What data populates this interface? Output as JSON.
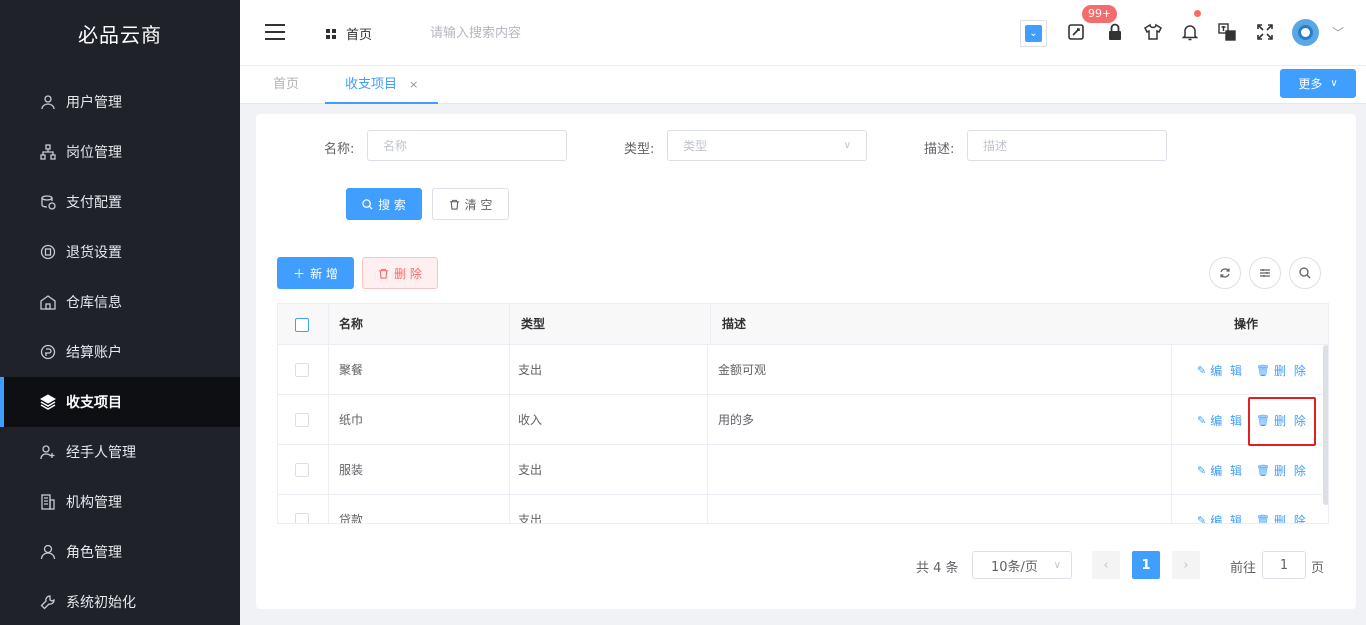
{
  "brand": "必品云商",
  "sidebar": {
    "items": [
      {
        "label": "用户管理",
        "icon": "user-icon"
      },
      {
        "label": "岗位管理",
        "icon": "org-chart-icon"
      },
      {
        "label": "支付配置",
        "icon": "coins-icon"
      },
      {
        "label": "退货设置",
        "icon": "return-icon"
      },
      {
        "label": "仓库信息",
        "icon": "warehouse-icon"
      },
      {
        "label": "结算账户",
        "icon": "account-icon"
      },
      {
        "label": "收支项目",
        "icon": "layers-icon",
        "active": true
      },
      {
        "label": "经手人管理",
        "icon": "user-add-icon"
      },
      {
        "label": "机构管理",
        "icon": "building-icon"
      },
      {
        "label": "角色管理",
        "icon": "role-icon"
      },
      {
        "label": "系统初始化",
        "icon": "wrench-icon"
      }
    ]
  },
  "header": {
    "home_label": "首页",
    "search_placeholder": "请输入搜索内容",
    "badge": "99+",
    "icons": [
      "dropdown-icon",
      "tool-icon",
      "lock-icon",
      "shirt-icon",
      "bell-icon",
      "translate-icon",
      "fullscreen-icon",
      "avatar",
      "chevron-down-icon"
    ]
  },
  "tabs": {
    "home": "首页",
    "active": "收支项目",
    "close": "×",
    "more": "更多"
  },
  "filters": {
    "name_label": "名称:",
    "name_placeholder": "名称",
    "type_label": "类型:",
    "type_placeholder": "类型",
    "desc_label": "描述:",
    "desc_placeholder": "描述",
    "search_btn": "搜 索",
    "clear_btn": "清 空"
  },
  "toolbar": {
    "add_btn": "新 增",
    "delete_btn": "删 除"
  },
  "table": {
    "columns": [
      "名称",
      "类型",
      "描述",
      "操作"
    ],
    "rows": [
      {
        "name": "聚餐",
        "type": "支出",
        "desc": "金额可观"
      },
      {
        "name": "纸巾",
        "type": "收入",
        "desc": "用的多"
      },
      {
        "name": "服装",
        "type": "支出",
        "desc": ""
      },
      {
        "name": "贷款",
        "type": "支出",
        "desc": ""
      }
    ],
    "edit_label": "编 辑",
    "delete_label": "删 除"
  },
  "pagination": {
    "total": "共 4 条",
    "page_size": "10条/页",
    "current_page": "1",
    "goto_label": "前往",
    "goto_value": "1",
    "page_suffix": "页"
  },
  "colors": {
    "primary": "#409eff",
    "danger": "#f56c6c",
    "sidebar_bg": "#1f2329",
    "highlight": "#e02020"
  }
}
